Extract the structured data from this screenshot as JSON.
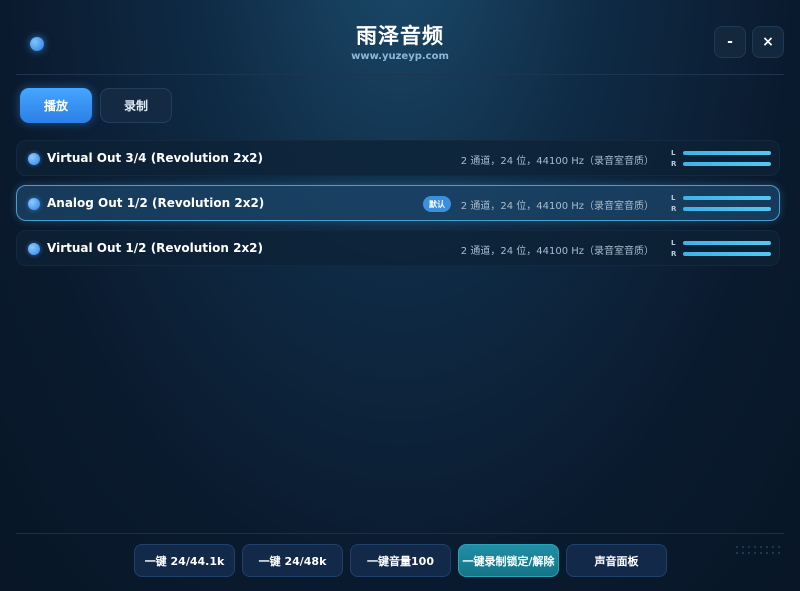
{
  "app": {
    "title": "雨泽音频",
    "subtitle": "www.yuzeyp.com",
    "minimize_label": "-",
    "close_label": "×"
  },
  "tabs": [
    {
      "label": "播放",
      "active": true
    },
    {
      "label": "录制",
      "active": false
    }
  ],
  "devices": [
    {
      "name": "Virtual Out 3/4 (Revolution 2x2)",
      "info": "2 通道，24 位，44100 Hz（录音室音质）",
      "badge": "",
      "selected": false,
      "meter": {
        "l_label": "L",
        "r_label": "R"
      }
    },
    {
      "name": "Analog Out 1/2 (Revolution 2x2)",
      "info": "2 通道，24 位，44100 Hz（录音室音质）",
      "badge": "默认",
      "selected": true,
      "meter": {
        "l_label": "L",
        "r_label": "R"
      }
    },
    {
      "name": "Virtual Out 1/2 (Revolution 2x2)",
      "info": "2 通道，24 位，44100 Hz（录音室音质）",
      "badge": "",
      "selected": false,
      "meter": {
        "l_label": "L",
        "r_label": "R"
      }
    }
  ],
  "bottom_buttons": [
    {
      "label": "一键 24/44.1k"
    },
    {
      "label": "一键 24/48k"
    },
    {
      "label": "一键音量100"
    },
    {
      "label": "一键录制锁定/解除"
    },
    {
      "label": "声音面板"
    }
  ],
  "colors": {
    "accent": "#3b8fe0",
    "meter": "#4ec0ef",
    "teal": "#1f8fa6"
  }
}
